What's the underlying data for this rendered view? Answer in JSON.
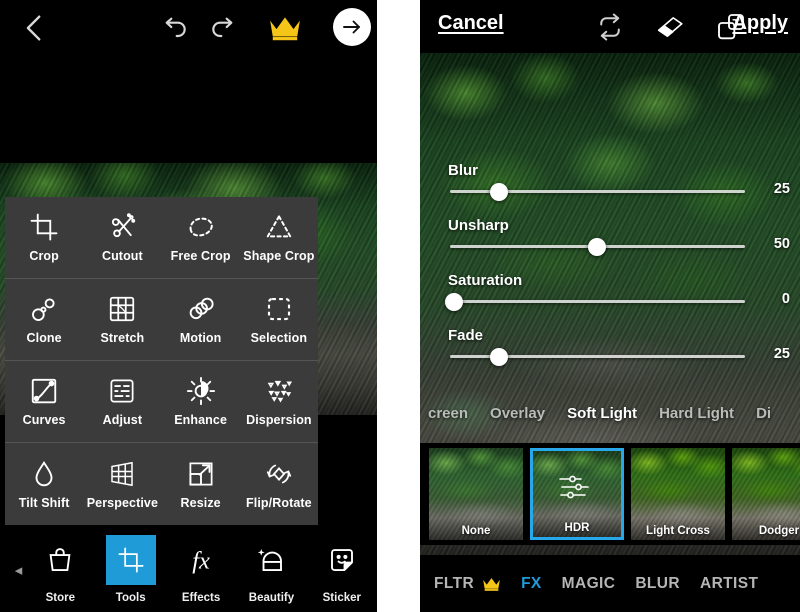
{
  "colors": {
    "accent_blue": "#1f9bd8",
    "filter_select_blue": "#28a8e8",
    "crown_gold": "#f5c518",
    "overlay_gray": "#3b3b3b",
    "app_black": "#000000"
  },
  "left_screen": {
    "topbar": {
      "back_icon": "back-chevron-icon",
      "undo_icon": "undo-icon",
      "redo_icon": "redo-icon",
      "premium_icon": "crown-icon",
      "next_icon": "arrow-right-circle-icon"
    },
    "tools_grid": {
      "rows": [
        [
          {
            "label": "Crop",
            "icon": "crop-icon"
          },
          {
            "label": "Cutout",
            "icon": "cutout-icon"
          },
          {
            "label": "Free Crop",
            "icon": "free-crop-icon"
          },
          {
            "label": "Shape Crop",
            "icon": "shape-crop-icon"
          }
        ],
        [
          {
            "label": "Clone",
            "icon": "clone-icon"
          },
          {
            "label": "Stretch",
            "icon": "stretch-icon"
          },
          {
            "label": "Motion",
            "icon": "motion-icon"
          },
          {
            "label": "Selection",
            "icon": "selection-icon"
          }
        ],
        [
          {
            "label": "Curves",
            "icon": "curves-icon"
          },
          {
            "label": "Adjust",
            "icon": "adjust-icon"
          },
          {
            "label": "Enhance",
            "icon": "enhance-icon"
          },
          {
            "label": "Dispersion",
            "icon": "dispersion-icon"
          }
        ],
        [
          {
            "label": "Tilt Shift",
            "icon": "tilt-shift-icon"
          },
          {
            "label": "Perspective",
            "icon": "perspective-icon"
          },
          {
            "label": "Resize",
            "icon": "resize-icon"
          },
          {
            "label": "Flip/Rotate",
            "icon": "flip-rotate-icon"
          }
        ]
      ]
    },
    "bottom_nav": {
      "prev_arrow": "◂",
      "items": [
        {
          "label": "Store",
          "icon": "store-bag-icon",
          "active": false
        },
        {
          "label": "Tools",
          "icon": "crop-icon",
          "active": true
        },
        {
          "label": "Effects",
          "icon": "fx-icon",
          "active": false
        },
        {
          "label": "Beautify",
          "icon": "beautify-face-icon",
          "active": false
        },
        {
          "label": "Sticker",
          "icon": "sticker-icon",
          "active": false
        }
      ]
    }
  },
  "right_screen": {
    "topbar": {
      "cancel_label": "Cancel",
      "apply_label": "Apply",
      "reset_icon": "refresh-cycle-icon",
      "eraser_icon": "eraser-icon",
      "mask_icon": "mask-layers-icon"
    },
    "sliders": [
      {
        "label": "Blur",
        "value": "25",
        "percent": 25
      },
      {
        "label": "Unsharp",
        "value": "50",
        "percent": 50
      },
      {
        "label": "Saturation",
        "value": "0",
        "percent": 0
      },
      {
        "label": "Fade",
        "value": "25",
        "percent": 25
      }
    ],
    "blend_modes": {
      "items": [
        {
          "label": "creen",
          "selected": false
        },
        {
          "label": "Overlay",
          "selected": false
        },
        {
          "label": "Soft Light",
          "selected": true
        },
        {
          "label": "Hard Light",
          "selected": false
        },
        {
          "label": "Di",
          "selected": false
        }
      ]
    },
    "filters": [
      {
        "label": "None",
        "selected": false,
        "style": "warm"
      },
      {
        "label": "HDR",
        "selected": true,
        "style": "warm",
        "badge_icon": "sliders-badge-icon"
      },
      {
        "label": "Light Cross",
        "selected": false,
        "style": "cool"
      },
      {
        "label": "Dodger",
        "selected": false,
        "style": "cool"
      }
    ],
    "tabs": [
      {
        "label": "FLTR",
        "active": false,
        "crown": true
      },
      {
        "label": "FX",
        "active": true,
        "crown": false
      },
      {
        "label": "MAGIC",
        "active": false,
        "crown": false
      },
      {
        "label": "BLUR",
        "active": false,
        "crown": false
      },
      {
        "label": "ARTIST",
        "active": false,
        "crown": false
      }
    ]
  }
}
